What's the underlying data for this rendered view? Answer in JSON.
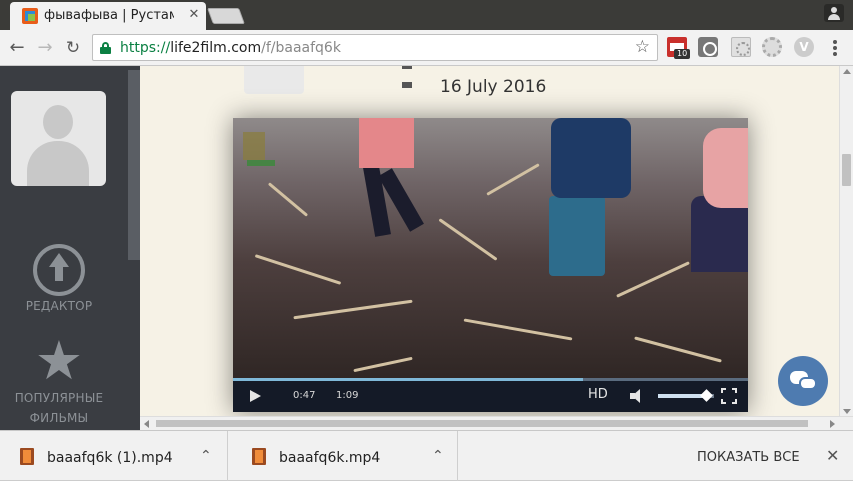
{
  "browser": {
    "tab_title": "фывафыва | Рустам",
    "tab_close": "✕",
    "url_scheme": "https://",
    "url_host": "life2film.com",
    "url_path": "/f/baaafq6k",
    "bookmark_star": "☆",
    "nav_back": "←",
    "nav_forward": "→",
    "nav_reload": "↻",
    "extension_badge": "10"
  },
  "sidebar": {
    "editor_label": "РЕДАКТОР",
    "popular_label": "ПОПУЛЯРНЫЕ ФИЛЬМЫ",
    "star_glyph": "★"
  },
  "post": {
    "date": "16 July 2016"
  },
  "video": {
    "current_time": "0:47",
    "duration": "1:09",
    "quality_label": "HD",
    "progress_fraction": 0.68,
    "volume_fraction": 0.85
  },
  "downloads": {
    "items": [
      {
        "name": "baaafq6k (1).mp4",
        "chevron": "⌃"
      },
      {
        "name": "baaafq6k.mp4",
        "chevron": "⌃"
      }
    ],
    "show_all_label": "ПОКАЗАТЬ ВСЕ",
    "close": "✕"
  }
}
